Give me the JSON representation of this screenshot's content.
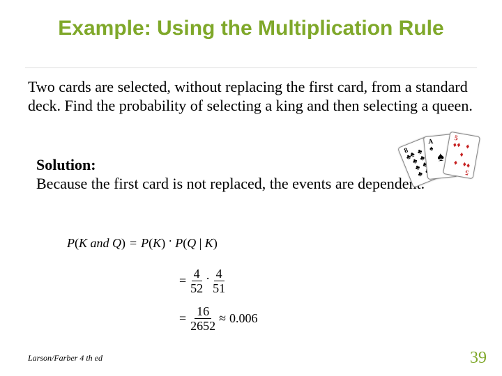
{
  "title": "Example: Using the Multiplication Rule",
  "problem": "Two cards are selected, without replacing the first card, from a standard deck. Find the probability of selecting a king and then selecting a queen.",
  "solution": {
    "label": "Solution:",
    "text": "Because the first card is not replaced, the events are dependent."
  },
  "math": {
    "lhs_full": "P(K and Q) = P(K) · P(Q | K)",
    "line1": {
      "lhs": "P(K and Q)",
      "rhs": "P(K) · P(Q | K)"
    },
    "line2": {
      "f1_num": "4",
      "f1_den": "52",
      "f2_num": "4",
      "f2_den": "51"
    },
    "line3": {
      "f_num": "16",
      "f_den": "2652",
      "approx": "0.006"
    }
  },
  "cards": [
    {
      "rank": "8",
      "suit": "club",
      "color": "blk"
    },
    {
      "rank": "A",
      "suit": "spade",
      "color": "blk"
    },
    {
      "rank": "5",
      "suit": "diamond",
      "color": "red"
    }
  ],
  "footer_left": "Larson/Farber 4 th ed",
  "page_number": "39"
}
